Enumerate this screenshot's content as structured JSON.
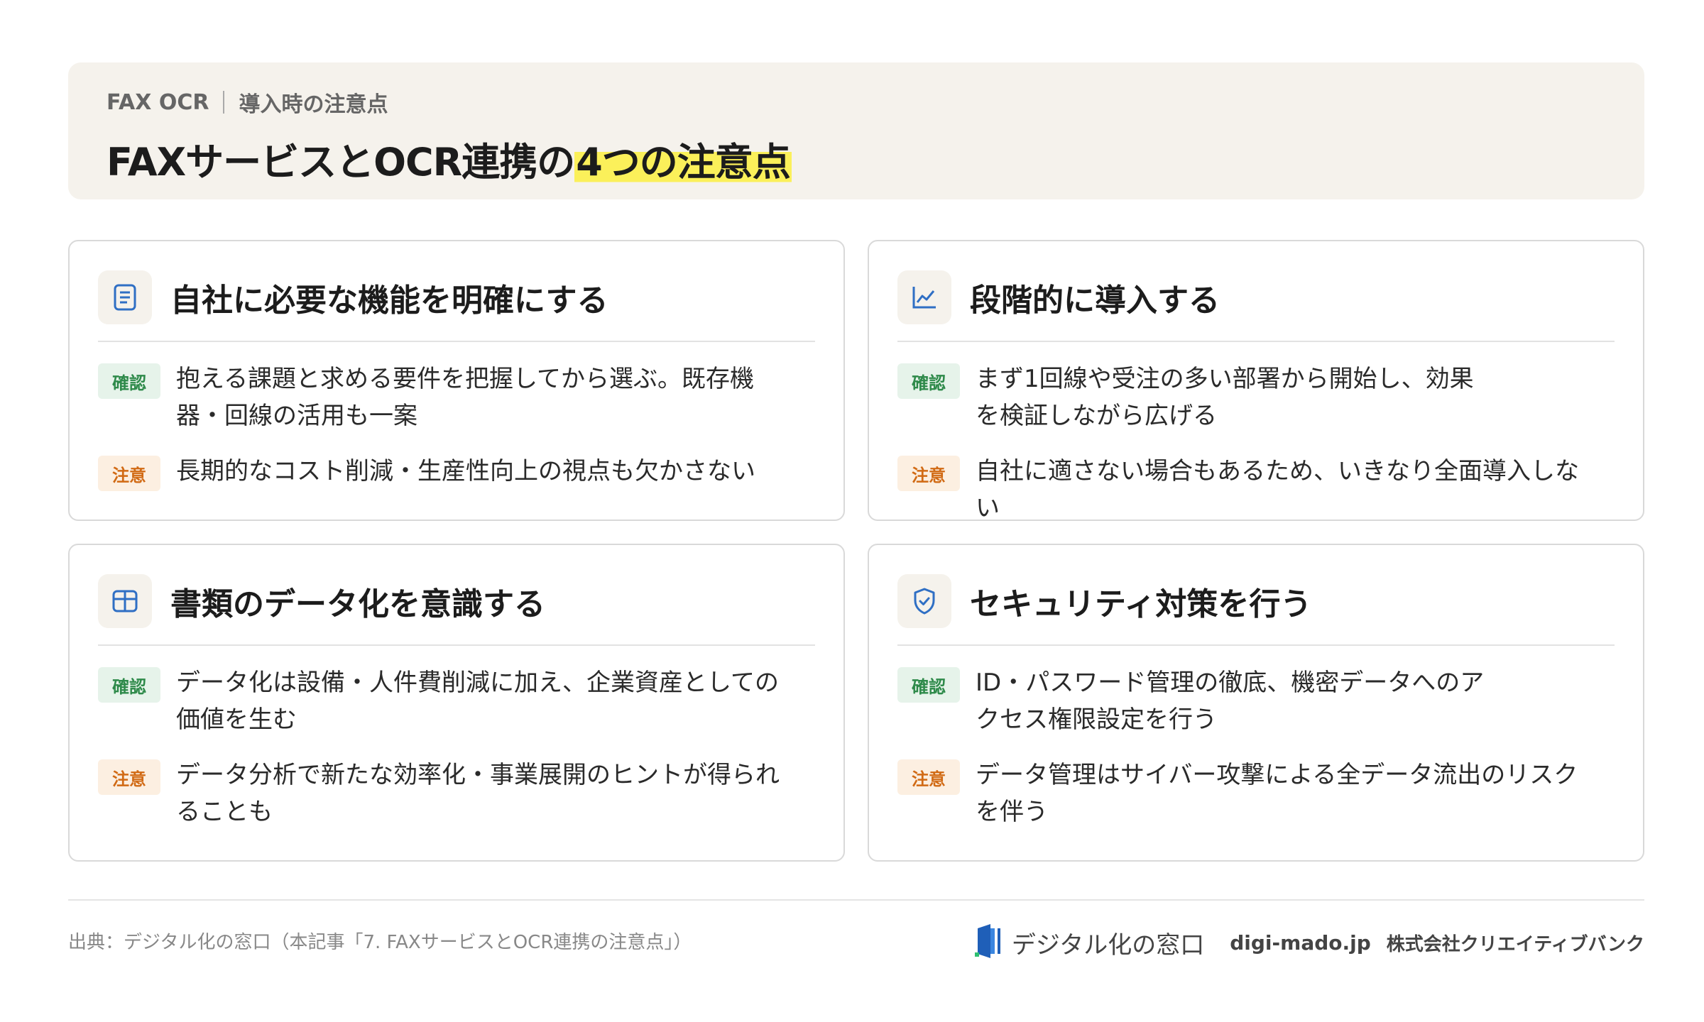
{
  "header": {
    "category": "FAX OCR",
    "subcategory": "導入時の注意点",
    "title_main": "FAXサービスとOCR連携の",
    "title_highlight": "4つの注意点"
  },
  "cards": [
    {
      "icon": "document-icon",
      "title": "自社に必要な機能を明確にする",
      "items": [
        {
          "badge": "確認",
          "type": "confirm",
          "text": "抱える課題と求める要件を把握してから選ぶ。既存機器・回線の活用も一案"
        },
        {
          "badge": "注意",
          "type": "caution",
          "text": "長期的なコスト削減・生産性向上の視点も欠かさない"
        }
      ]
    },
    {
      "icon": "line-chart-icon",
      "title": "段階的に導入する",
      "items": [
        {
          "badge": "確認",
          "type": "confirm",
          "text": "まず1回線や受注の多い部署から開始し、効果を検証しながら広げる"
        },
        {
          "badge": "注意",
          "type": "caution",
          "text": "自社に適さない場合もあるため、いきなり全面導入しない"
        }
      ]
    },
    {
      "icon": "table-icon",
      "title": "書類のデータ化を意識する",
      "items": [
        {
          "badge": "確認",
          "type": "confirm",
          "text": "データ化は設備・人件費削減に加え、企業資産としての価値を生む"
        },
        {
          "badge": "注意",
          "type": "caution",
          "text": "データ分析で新たな効率化・事業展開のヒントが得られることも"
        }
      ]
    },
    {
      "icon": "shield-check-icon",
      "title": "セキュリティ対策を行う",
      "items": [
        {
          "badge": "確認",
          "type": "confirm",
          "text": "ID・パスワード管理の徹底、機密データへのアクセス権限設定を行う"
        },
        {
          "badge": "注意",
          "type": "caution",
          "text": "データ管理はサイバー攻撃による全データ流出のリスクを伴う"
        }
      ]
    }
  ],
  "footer": {
    "source": "出典：デジタル化の窓口（本記事「7. FAXサービスとOCR連携の注意点」）",
    "brand_name": "デジタル化の窓口",
    "brand_url": "digi-mado.jp",
    "company": "株式会社クリエイティブバンク"
  },
  "colors": {
    "header_bg": "#f5f2ec",
    "highlight": "#fbf05a",
    "icon_blue": "#2f6fc4",
    "confirm_badge": "#2e8a4a",
    "caution_badge": "#d16a14"
  }
}
